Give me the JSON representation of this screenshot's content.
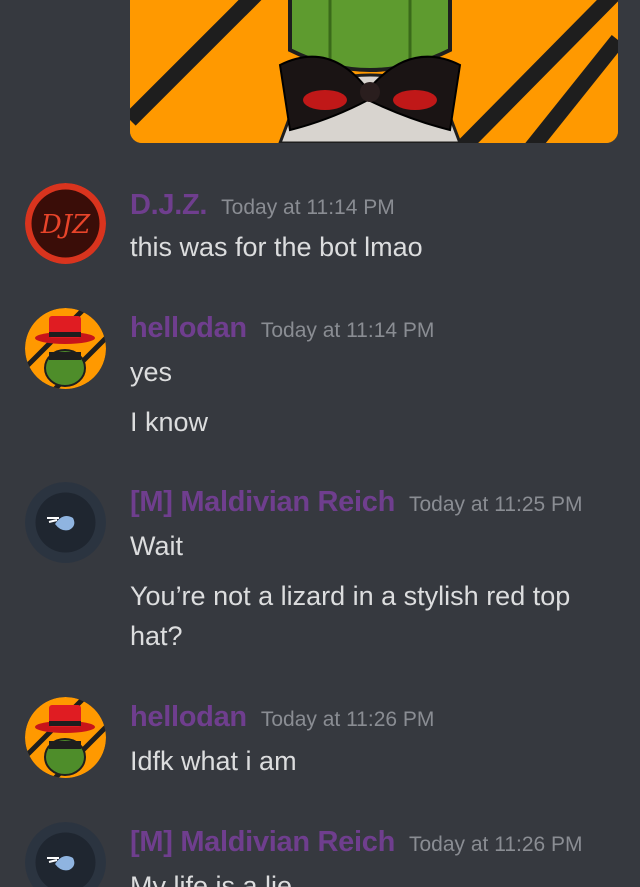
{
  "messages": [
    {
      "username": "D.J.Z.",
      "timestamp": "Today at 11:14 PM",
      "lines": [
        "this was for the bot lmao"
      ],
      "avatar": "djz-logo-avatar"
    },
    {
      "username": "hellodan",
      "timestamp": "Today at 11:14 PM",
      "lines": [
        "yes",
        "I know"
      ],
      "avatar": "lizard-top-hat-avatar"
    },
    {
      "username": "[M] Maldivian Reich",
      "timestamp": "Today at 11:25 PM",
      "lines": [
        "Wait",
        "You’re not a lizard in a stylish red top hat?"
      ],
      "avatar": "flag-map-avatar"
    },
    {
      "username": "hellodan",
      "timestamp": "Today at 11:26 PM",
      "lines": [
        "Idfk what i am"
      ],
      "avatar": "lizard-top-hat-avatar"
    },
    {
      "username": "[M] Maldivian Reich",
      "timestamp": "Today at 11:26 PM",
      "lines": [
        "My life is a lie"
      ],
      "avatar": "flag-map-avatar"
    }
  ],
  "colors": {
    "background": "#36393f",
    "username": "#6f3e8e",
    "timestamp": "#8a8d93",
    "text": "#dcddde"
  }
}
